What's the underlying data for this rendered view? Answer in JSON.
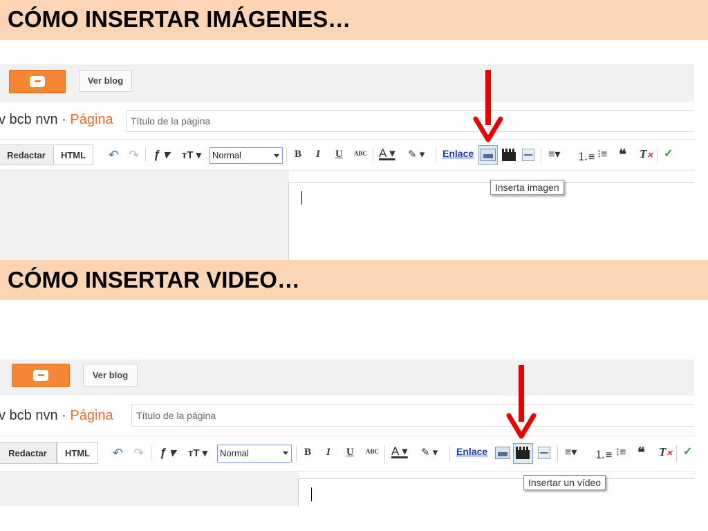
{
  "sections": [
    {
      "heading": "CÓMO INSERTAR IMÁGENES…",
      "screenshot": {
        "view_blog_button": "Ver blog",
        "blog_name": "v bcb nvn · ",
        "page_label": "Página",
        "title_placeholder": "Título de la página",
        "mode_compose": "Redactar",
        "mode_html": "HTML",
        "font_size_select": "Normal",
        "bold": "B",
        "italic": "I",
        "underline": "U",
        "strikethrough": "ABC",
        "text_color": "A",
        "link": "Enlace",
        "tooltip": "Inserta imagen"
      }
    },
    {
      "heading": "CÓMO INSERTAR VIDEO…",
      "screenshot": {
        "view_blog_button": "Ver blog",
        "blog_name": "v bcb nvn · ",
        "page_label": "Página",
        "title_placeholder": "Título de la página",
        "mode_compose": "Redactar",
        "mode_html": "HTML",
        "font_size_select": "Normal",
        "bold": "B",
        "italic": "I",
        "underline": "U",
        "strikethrough": "ABC",
        "text_color": "A",
        "link": "Enlace",
        "tooltip": "Insertar un vídeo"
      }
    }
  ],
  "colors": {
    "banner_bg": "#fbd5b5",
    "arrow": "#e60000",
    "blogger_orange": "#f48634",
    "link_blue": "#1a3cbb",
    "page_orange": "#f26a2a"
  },
  "icons": [
    "blogger-logo-icon",
    "undo-icon",
    "redo-icon",
    "font-icon",
    "font-size-icon",
    "highlight-icon",
    "insert-image-icon",
    "insert-video-icon",
    "jump-break-icon",
    "align-icon",
    "numbered-list-icon",
    "bullet-list-icon",
    "quote-icon",
    "remove-format-icon",
    "spellcheck-icon",
    "down-arrow-annotation"
  ]
}
